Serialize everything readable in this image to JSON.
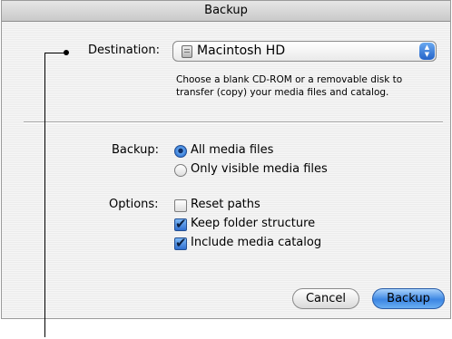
{
  "window": {
    "title": "Backup"
  },
  "destination": {
    "label": "Destination:",
    "selected": "Macintosh HD",
    "icon": "hard-disk-icon",
    "hint_line1": "Choose a blank CD-ROM or a removable disk to",
    "hint_line2": "transfer (copy) your media files and catalog."
  },
  "backup": {
    "label": "Backup:",
    "options": [
      {
        "label": "All media files",
        "selected": true
      },
      {
        "label": "Only visible media files",
        "selected": false
      }
    ]
  },
  "options": {
    "label": "Options:",
    "items": [
      {
        "label": "Reset paths",
        "checked": false
      },
      {
        "label": "Keep folder structure",
        "checked": true
      },
      {
        "label": "Include media catalog",
        "checked": true
      }
    ]
  },
  "buttons": {
    "cancel": "Cancel",
    "backup": "Backup"
  },
  "colors": {
    "accent": "#3c86e3",
    "window_bg": "#eeeeee"
  }
}
